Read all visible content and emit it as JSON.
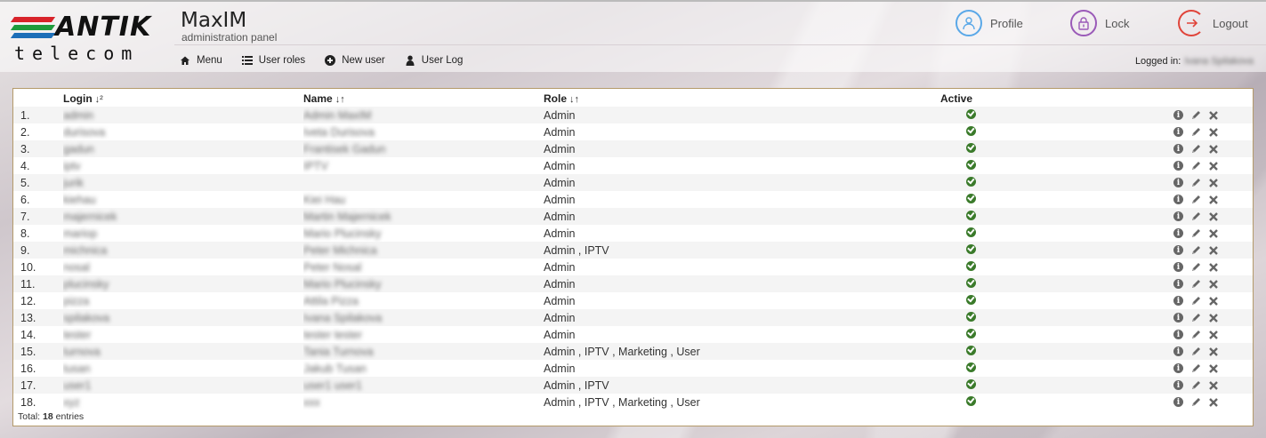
{
  "brand": {
    "logo_word": "ANTIK",
    "logo_sub": "telecom",
    "bar_colors": [
      "#d8232a",
      "#1e9b3c",
      "#1d6fb8"
    ]
  },
  "app": {
    "title": "MaxIM",
    "subtitle": "administration panel"
  },
  "top_actions": [
    {
      "label": "Profile",
      "icon": "user-circle-icon",
      "color": "#5aa8e8"
    },
    {
      "label": "Lock",
      "icon": "lock-circle-icon",
      "color": "#9a5ab8"
    },
    {
      "label": "Logout",
      "icon": "logout-circle-icon",
      "color": "#e0443a"
    }
  ],
  "nav": [
    {
      "label": "Menu",
      "icon": "home-icon"
    },
    {
      "label": "User roles",
      "icon": "list-icon"
    },
    {
      "label": "New user",
      "icon": "plus-circle-icon"
    },
    {
      "label": "User Log",
      "icon": "user-icon"
    }
  ],
  "logged_in": {
    "label": "Logged in:",
    "user": "Ivana Spilakova"
  },
  "table": {
    "columns": {
      "login": "Login",
      "name": "Name",
      "role": "Role",
      "active": "Active"
    },
    "rows": [
      {
        "num": "1.",
        "login": "admin",
        "name": "Admin MaxIM",
        "role": "Admin"
      },
      {
        "num": "2.",
        "login": "durisova",
        "name": "Iveta Durisova",
        "role": "Admin"
      },
      {
        "num": "3.",
        "login": "gadun",
        "name": "Frantisek Gadun",
        "role": "Admin"
      },
      {
        "num": "4.",
        "login": "iptv",
        "name": "IPTV",
        "role": "Admin"
      },
      {
        "num": "5.",
        "login": "jurik",
        "name": "",
        "role": "Admin"
      },
      {
        "num": "6.",
        "login": "kiehau",
        "name": "Kiei Hau",
        "role": "Admin"
      },
      {
        "num": "7.",
        "login": "majernicek",
        "name": "Martin Majernicek",
        "role": "Admin"
      },
      {
        "num": "8.",
        "login": "mariop",
        "name": "Mario Plucinsky",
        "role": "Admin"
      },
      {
        "num": "9.",
        "login": "michnica",
        "name": "Peter Michnica",
        "role": "Admin , IPTV"
      },
      {
        "num": "10.",
        "login": "nosal",
        "name": "Peter Nosal",
        "role": "Admin"
      },
      {
        "num": "11.",
        "login": "plucinsky",
        "name": "Mario Plucinsky",
        "role": "Admin"
      },
      {
        "num": "12.",
        "login": "pizza",
        "name": "Attila Pizza",
        "role": "Admin"
      },
      {
        "num": "13.",
        "login": "spilakova",
        "name": "Ivana Spilakova",
        "role": "Admin"
      },
      {
        "num": "14.",
        "login": "tester",
        "name": "tester tester",
        "role": "Admin"
      },
      {
        "num": "15.",
        "login": "turnova",
        "name": "Tania Turnova",
        "role": "Admin , IPTV , Marketing , User"
      },
      {
        "num": "16.",
        "login": "tusan",
        "name": "Jakub Tusan",
        "role": "Admin"
      },
      {
        "num": "17.",
        "login": "user1",
        "name": "user1 user1",
        "role": "Admin , IPTV"
      },
      {
        "num": "18.",
        "login": "xyz",
        "name": "xxx",
        "role": "Admin , IPTV , Marketing , User"
      }
    ]
  },
  "footer": {
    "total_label": "Total:",
    "total_count": "18",
    "total_suffix": "entries"
  }
}
